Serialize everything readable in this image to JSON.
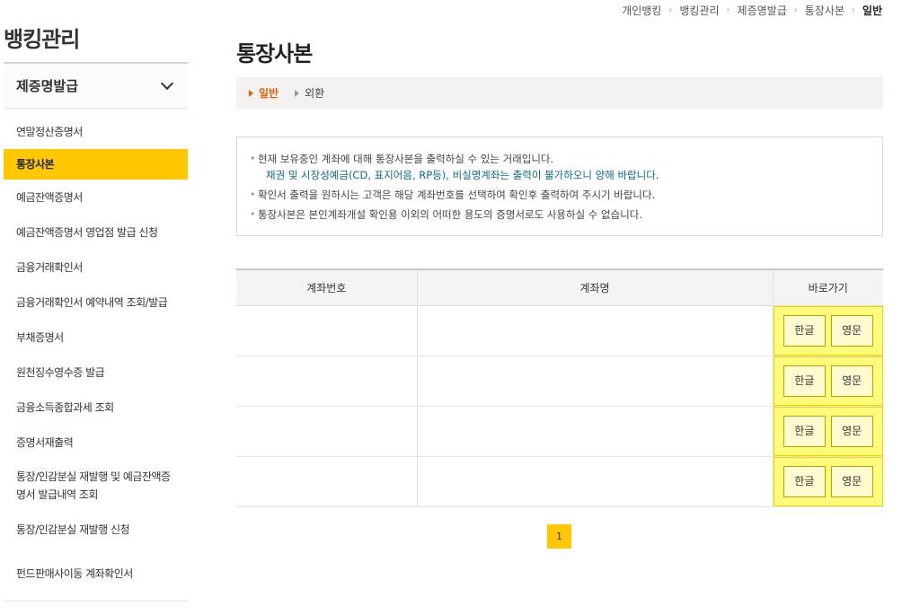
{
  "breadcrumb": [
    "개인뱅킹",
    "뱅킹관리",
    "제증명발급",
    "통장사본",
    "일반"
  ],
  "side_title": "뱅킹관리",
  "sidebar": {
    "header": "제증명발급",
    "items": [
      {
        "label": "연말정산증명서"
      },
      {
        "label": "통장사본"
      },
      {
        "label": "예금잔액증명서"
      },
      {
        "label": "예금잔액증명서 영업점 발급 신청"
      },
      {
        "label": "금융거래확인서"
      },
      {
        "label": "금융거래확인서 예약내역 조회/발급"
      },
      {
        "label": "부채증명서"
      },
      {
        "label": "원천징수영수증 발급"
      },
      {
        "label": "금융소득종합과세 조회"
      },
      {
        "label": "증명서재출력"
      },
      {
        "label": "통장/인감분실 재발행 및 예금잔액증명서 발급내역 조회"
      },
      {
        "label": "통장/인감분실 재발행 신청"
      },
      {
        "label": "펀드판매사이동 계좌확인서"
      }
    ]
  },
  "page_title": "통장사본",
  "subtabs": [
    {
      "label": "일반"
    },
    {
      "label": "외환"
    }
  ],
  "notice": {
    "line1": "현재 보유중인 계좌에 대해 통장사본을 출력하실 수 있는 거래입니다.",
    "line1_sub": "채권 및 시장성예금(CD, 표지어음, RP등), 비실명계좌는 출력이 불가하오니 양해 바랍니다.",
    "line2": "확인서 출력을 원하시는 고객은 해당 계좌번호를 선택하여 확인후 출력하여 주시기 바랍니다.",
    "line3": "통장사본은 본인계좌개설 확인용 이외의 어떠한 용도의 증명서로도 사용하실 수 없습니다."
  },
  "table": {
    "headers": [
      "계좌번호",
      "계좌명",
      "바로가기"
    ],
    "rows": [
      {
        "account": "",
        "name": "",
        "btn_ko": "한글",
        "btn_en": "영문"
      },
      {
        "account": "",
        "name": "",
        "btn_ko": "한글",
        "btn_en": "영문"
      },
      {
        "account": "",
        "name": "",
        "btn_ko": "한글",
        "btn_en": "영문"
      },
      {
        "account": "",
        "name": "",
        "btn_ko": "한글",
        "btn_en": "영문"
      }
    ]
  },
  "pagination": {
    "current": "1"
  },
  "colors": {
    "accent": "#ffc800",
    "active_tab": "#e2600d",
    "notice_sub": "#0a6a8a",
    "highlight": "#fffb7a"
  }
}
